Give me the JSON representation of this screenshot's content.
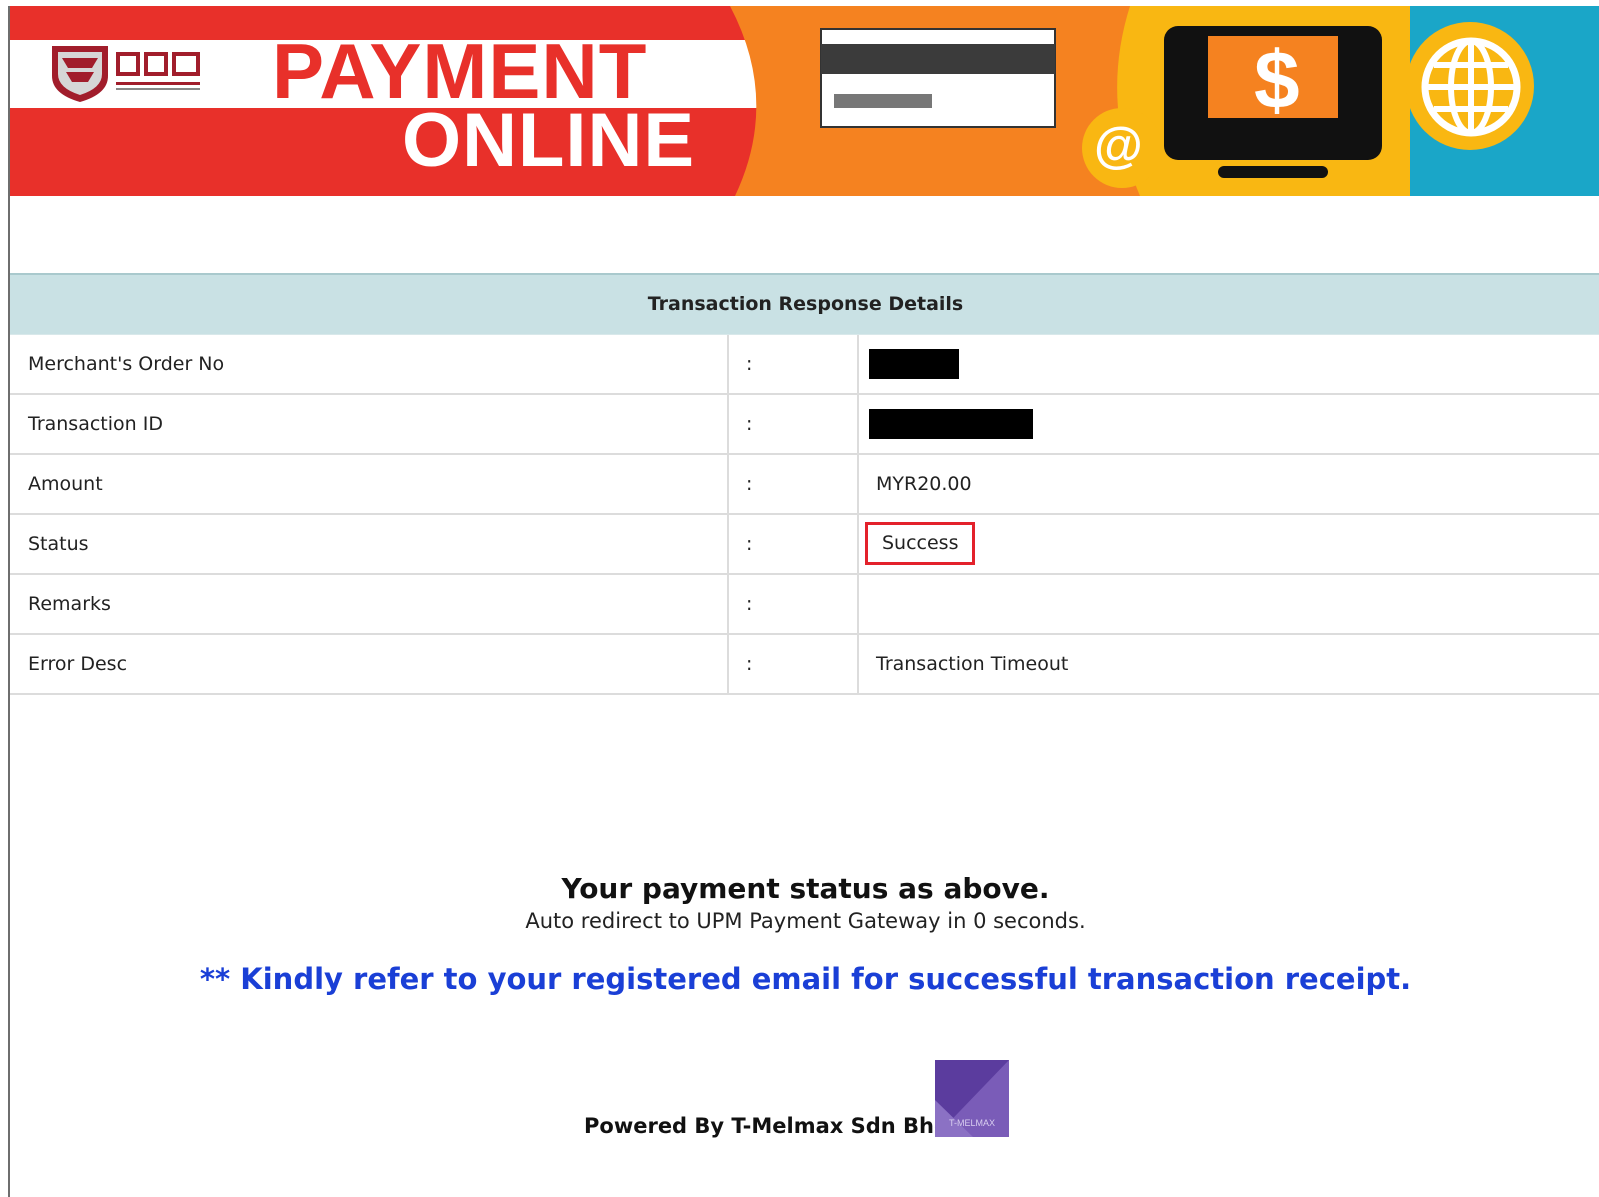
{
  "banner": {
    "brand": "UPM",
    "title_line1": "PAYMENT",
    "title_line2": "ONLINE",
    "dollar_symbol": "$",
    "at_symbol": "@",
    "colors": {
      "red": "#e8302a",
      "orange": "#f58220",
      "yellow": "#f9b712",
      "teal": "#1aa6c8"
    }
  },
  "table": {
    "header": "Transaction Response Details",
    "rows": [
      {
        "label": "Merchant's Order No",
        "colon": ":",
        "value": "",
        "redacted": true
      },
      {
        "label": "Transaction ID",
        "colon": ":",
        "value": "",
        "redacted": true
      },
      {
        "label": "Amount",
        "colon": ":",
        "value": "MYR20.00"
      },
      {
        "label": "Status",
        "colon": ":",
        "value": "Success",
        "highlight": "#e3212b"
      },
      {
        "label": "Remarks",
        "colon": ":",
        "value": ""
      },
      {
        "label": "Error Desc",
        "colon": ":",
        "value": "Transaction Timeout"
      }
    ]
  },
  "messages": {
    "main": "Your payment status as above.",
    "redirect": "Auto redirect to UPM Payment Gateway in 0 seconds.",
    "note": "** Kindly refer to your registered email for successful transaction receipt.",
    "note_color": "#1a3fd6",
    "powered_by": "Powered By T-Melmax Sdn Bhd",
    "powered_logo_text": "T-MELMAX"
  }
}
